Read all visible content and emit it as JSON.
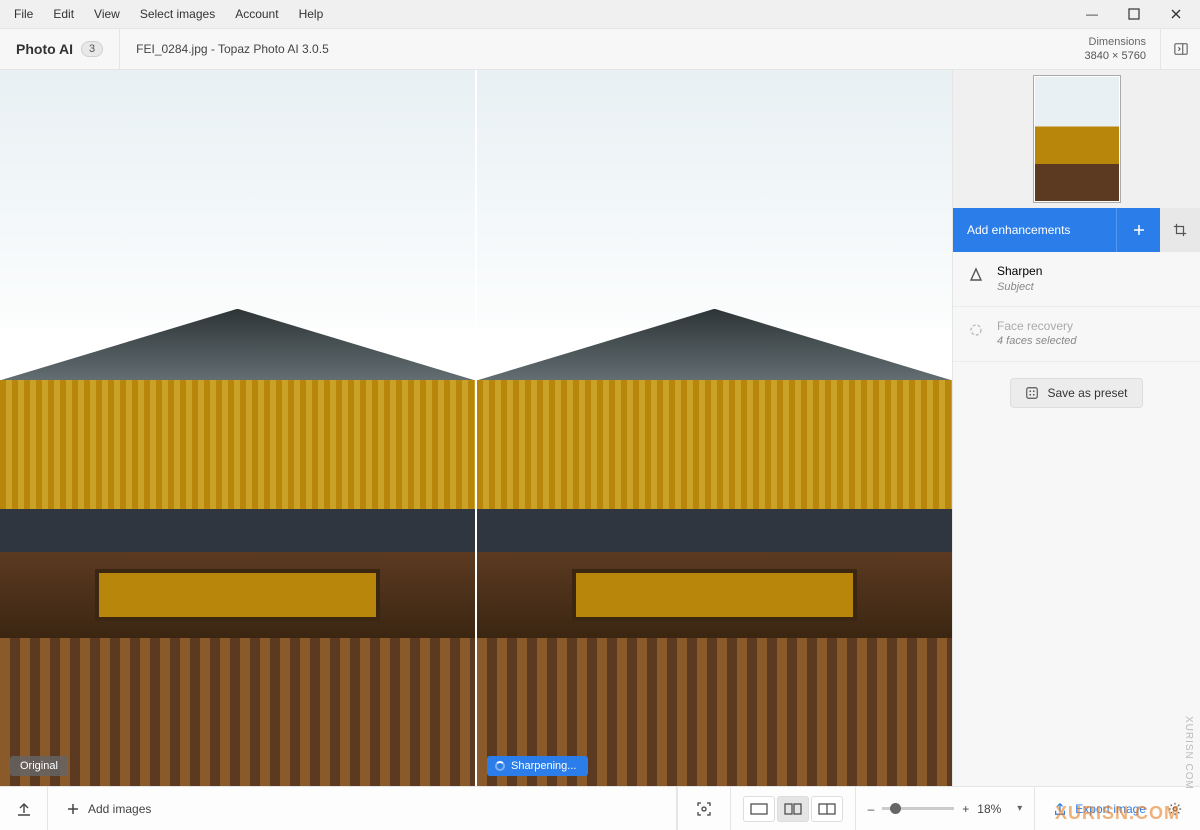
{
  "menu": {
    "items": [
      "File",
      "Edit",
      "View",
      "Select images",
      "Account",
      "Help"
    ]
  },
  "window": {
    "minimize": "–",
    "maximize": "▢",
    "close": "✕"
  },
  "titlebar": {
    "brand": "Photo AI",
    "badge": "3",
    "filename": "FEI_0284.jpg - Topaz Photo AI 3.0.5",
    "dimensions_label": "Dimensions",
    "dimensions_value": "3840 × 5760"
  },
  "viewer": {
    "left_label": "Original",
    "right_status": "Sharpening..."
  },
  "sidebar": {
    "add_enhancements": "Add enhancements",
    "items": [
      {
        "title": "Sharpen",
        "subtitle": "Subject"
      },
      {
        "title": "Face recovery",
        "subtitle": "4 faces selected"
      }
    ],
    "save_preset": "Save as preset"
  },
  "footer": {
    "add_images": "Add images",
    "zoom_percent": "18%",
    "export": "Export image"
  },
  "watermark_side": "XURISN COM",
  "watermark_brand": "XURISN.COM"
}
